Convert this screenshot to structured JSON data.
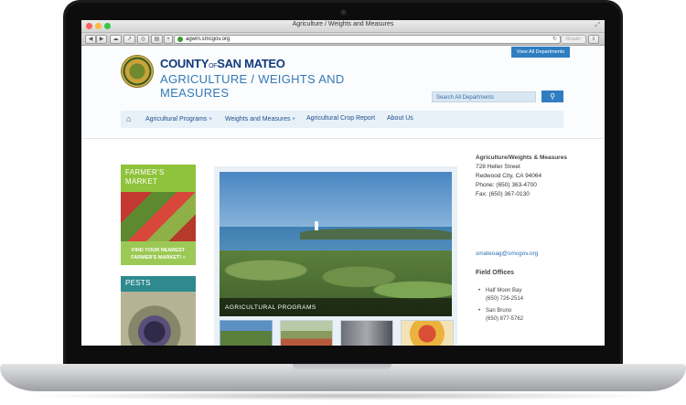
{
  "window": {
    "title": "Agriculture / Weights and Measures"
  },
  "browser": {
    "url": "agwm.smcgov.org",
    "reader_label": "Reader"
  },
  "header": {
    "view_all": "View All Departments",
    "county_left": "COUNTY",
    "county_of": "OF",
    "county_right": "SAN MATEO",
    "dept_title": "AGRICULTURE / WEIGHTS AND MEASURES",
    "search_placeholder": "Search All Departments"
  },
  "nav": {
    "items": [
      "Agricultural Programs",
      "Weights and Measures",
      "Agricultural Crop Report",
      "About Us"
    ]
  },
  "sidebar": {
    "cards": [
      {
        "title": "FARMER'S MARKET",
        "cta": "FIND YOUR NEAREST FARMER'S MARKET! »",
        "color": "#8fc33b"
      },
      {
        "title": "PESTS",
        "color": "#2e8a8f"
      }
    ]
  },
  "feature": {
    "caption": "AGRICULTURAL PROGRAMS"
  },
  "contact": {
    "title": "Agriculture/Weights & Measures",
    "street": "728 Heller Street",
    "city": "Redwood City, CA 94064",
    "phone": "Phone: (650) 363-4700",
    "fax": "Fax: (650) 367-0130",
    "email": "smateoag@smcgov.org",
    "offices_title": "Field Offices",
    "offices": [
      {
        "name": "Half Moon Bay",
        "phone": "(650) 726-2514"
      },
      {
        "name": "San Bruno",
        "phone": "(650) 877-5762"
      }
    ]
  },
  "colors": {
    "brand_blue": "#2f7dc1",
    "title_navy": "#123a7a",
    "market_green": "#8fc33b",
    "pests_teal": "#2e8a8f"
  }
}
